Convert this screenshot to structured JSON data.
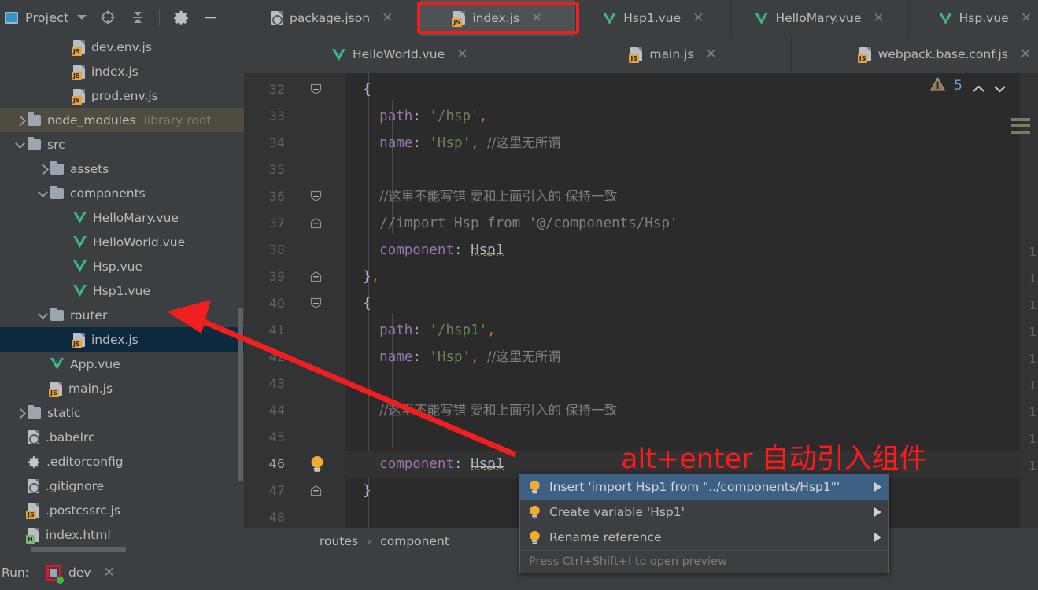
{
  "project_panel": {
    "title": "Project",
    "icons": [
      "project-window-icon",
      "chevron-down-icon",
      "locate-target-icon",
      "collapse-all-icon",
      "gear-icon",
      "minimize-icon"
    ],
    "tree": [
      {
        "label": "dev.env.js",
        "icon": "js-file-icon",
        "indent": 3,
        "arrow": "none"
      },
      {
        "label": "index.js",
        "icon": "js-file-icon",
        "indent": 3,
        "arrow": "none"
      },
      {
        "label": "prod.env.js",
        "icon": "js-file-icon",
        "indent": 3,
        "arrow": "none"
      },
      {
        "label": "node_modules",
        "icon": "folder-icon",
        "indent": 1,
        "arrow": "right",
        "sub": "library root",
        "state": "library"
      },
      {
        "label": "src",
        "icon": "folder-icon",
        "indent": 1,
        "arrow": "down"
      },
      {
        "label": "assets",
        "icon": "folder-icon",
        "indent": 2,
        "arrow": "right"
      },
      {
        "label": "components",
        "icon": "folder-icon",
        "indent": 2,
        "arrow": "down"
      },
      {
        "label": "HelloMary.vue",
        "icon": "vue-file-icon",
        "indent": 3,
        "arrow": "none"
      },
      {
        "label": "HelloWorld.vue",
        "icon": "vue-file-icon",
        "indent": 3,
        "arrow": "none"
      },
      {
        "label": "Hsp.vue",
        "icon": "vue-file-icon",
        "indent": 3,
        "arrow": "none"
      },
      {
        "label": "Hsp1.vue",
        "icon": "vue-file-icon",
        "indent": 3,
        "arrow": "none"
      },
      {
        "label": "router",
        "icon": "folder-icon",
        "indent": 2,
        "arrow": "down"
      },
      {
        "label": "index.js",
        "icon": "js-file-icon",
        "indent": 3,
        "arrow": "none",
        "state": "selected"
      },
      {
        "label": "App.vue",
        "icon": "vue-file-icon",
        "indent": 2,
        "arrow": "none"
      },
      {
        "label": "main.js",
        "icon": "js-file-icon",
        "indent": 2,
        "arrow": "none"
      },
      {
        "label": "static",
        "icon": "folder-icon",
        "indent": 1,
        "arrow": "right"
      },
      {
        "label": ".babelrc",
        "icon": "config-file-icon",
        "indent": 1,
        "arrow": "none"
      },
      {
        "label": ".editorconfig",
        "icon": "gear-file-icon",
        "indent": 1,
        "arrow": "none"
      },
      {
        "label": ".gitignore",
        "icon": "ignore-file-icon",
        "indent": 1,
        "arrow": "none"
      },
      {
        "label": ".postcssrc.js",
        "icon": "js-file-icon",
        "indent": 1,
        "arrow": "none"
      },
      {
        "label": "index.html",
        "icon": "html-file-icon",
        "indent": 1,
        "arrow": "none"
      }
    ]
  },
  "tabs": {
    "row1": [
      {
        "label": "package.json",
        "icon": "json-file-icon",
        "active": false
      },
      {
        "label": "index.js",
        "icon": "js-file-icon",
        "active": true,
        "highlighted": true
      },
      {
        "label": "Hsp1.vue",
        "icon": "vue-file-icon",
        "active": false
      },
      {
        "label": "HelloMary.vue",
        "icon": "vue-file-icon",
        "active": false
      },
      {
        "label": "Hsp.vue",
        "icon": "vue-file-icon",
        "active": false
      }
    ],
    "row2": [
      {
        "label": "HelloWorld.vue",
        "icon": "vue-file-icon",
        "active": false
      },
      {
        "label": "main.js",
        "icon": "js-file-icon",
        "active": false
      },
      {
        "label": "webpack.base.conf.js",
        "icon": "js-file-icon",
        "active": false
      }
    ]
  },
  "editor": {
    "first_line": 32,
    "current_line": 46,
    "warning_icon": "warning-triangle-icon",
    "warning_count": "5",
    "nav_up_icon": "chevron-up-icon",
    "nav_down_icon": "chevron-down-icon",
    "marks_icon": "inspection-marks-icon",
    "lines": [
      {
        "n": 32,
        "fold": "end-down",
        "segs": [
          {
            "t": "  {",
            "c": "brace"
          }
        ]
      },
      {
        "n": 33,
        "segs": [
          {
            "t": "    ",
            "c": "punct"
          },
          {
            "t": "path",
            "c": "key"
          },
          {
            "t": ": ",
            "c": "punct"
          },
          {
            "t": "'/hsp'",
            "c": "str"
          },
          {
            "t": ",",
            "c": "comma"
          }
        ]
      },
      {
        "n": 34,
        "segs": [
          {
            "t": "    ",
            "c": "punct"
          },
          {
            "t": "name",
            "c": "key"
          },
          {
            "t": ": ",
            "c": "punct"
          },
          {
            "t": "'Hsp'",
            "c": "str"
          },
          {
            "t": ",",
            "c": "comma"
          },
          {
            "t": " ",
            "c": "punct"
          },
          {
            "t": "//这里无所谓",
            "c": "comment-cn"
          }
        ]
      },
      {
        "n": 35,
        "segs": []
      },
      {
        "n": 36,
        "fold": "end-down",
        "segs": [
          {
            "t": "    ",
            "c": "punct"
          },
          {
            "t": "//这里不能写错 要和上面引入的 保持一致",
            "c": "comment-cn"
          }
        ]
      },
      {
        "n": 37,
        "fold": "end-up",
        "segs": [
          {
            "t": "    ",
            "c": "punct"
          },
          {
            "t": "//import Hsp from '@/components/Hsp'",
            "c": "comment"
          }
        ]
      },
      {
        "n": 38,
        "segs": [
          {
            "t": "    ",
            "c": "punct"
          },
          {
            "t": "component",
            "c": "key"
          },
          {
            "t": ": ",
            "c": "punct"
          },
          {
            "t": "Hsp1",
            "c": "ident-error"
          }
        ]
      },
      {
        "n": 39,
        "fold": "end-up",
        "segs": [
          {
            "t": "  }",
            "c": "brace"
          },
          {
            "t": ",",
            "c": "comma"
          }
        ]
      },
      {
        "n": 40,
        "fold": "end-down",
        "segs": [
          {
            "t": "  {",
            "c": "brace"
          }
        ]
      },
      {
        "n": 41,
        "segs": [
          {
            "t": "    ",
            "c": "punct"
          },
          {
            "t": "path",
            "c": "key"
          },
          {
            "t": ": ",
            "c": "punct"
          },
          {
            "t": "'/hsp1'",
            "c": "str"
          },
          {
            "t": ",",
            "c": "comma"
          }
        ]
      },
      {
        "n": 42,
        "segs": [
          {
            "t": "    ",
            "c": "punct"
          },
          {
            "t": "name",
            "c": "key"
          },
          {
            "t": ": ",
            "c": "punct"
          },
          {
            "t": "'Hsp'",
            "c": "str"
          },
          {
            "t": ",",
            "c": "comma"
          },
          {
            "t": " ",
            "c": "punct"
          },
          {
            "t": "//这里无所谓",
            "c": "comment-cn"
          }
        ]
      },
      {
        "n": 43,
        "segs": []
      },
      {
        "n": 44,
        "segs": [
          {
            "t": "    ",
            "c": "punct"
          },
          {
            "t": "//这里不能写错 要和上面引入的 保持一致",
            "c": "comment-cn"
          }
        ]
      },
      {
        "n": 45,
        "segs": []
      },
      {
        "n": 46,
        "bulb": true,
        "current": true,
        "segs": [
          {
            "t": "    ",
            "c": "punct"
          },
          {
            "t": "component",
            "c": "key"
          },
          {
            "t": ": ",
            "c": "punct"
          },
          {
            "t": "Hsp1",
            "c": "ident-error"
          }
        ]
      },
      {
        "n": 47,
        "fold": "end-up",
        "segs": [
          {
            "t": "  }",
            "c": "brace"
          }
        ]
      },
      {
        "n": 48,
        "segs": []
      }
    ]
  },
  "right_sliver": {
    "line_numbers": [
      "1",
      "1",
      "1",
      "1",
      "1",
      "1",
      "1",
      "1",
      "1"
    ]
  },
  "breadcrumb": {
    "items": [
      "routes",
      "component"
    ],
    "separator": "›"
  },
  "intention_popup": {
    "items": [
      {
        "label": "Insert 'import Hsp1 from \"../components/Hsp1\"'",
        "selected": true,
        "icon": "lightbulb-icon",
        "submenu": true
      },
      {
        "label": "Create variable 'Hsp1'",
        "selected": false,
        "icon": "lightbulb-icon",
        "submenu": true
      },
      {
        "label": "Rename reference",
        "selected": false,
        "icon": "lightbulb-icon",
        "submenu": true
      }
    ],
    "hint": "Press Ctrl+Shift+I to open preview"
  },
  "annotation": {
    "note": "alt+enter 自动引入组件",
    "color": "#ff1a1a",
    "arrow_icon": "red-arrow-pointer"
  },
  "status_bar": {
    "run_label": "Run:",
    "run_tab_label": "dev",
    "run_icon": "run-config-icon",
    "close_icon": "close-icon"
  },
  "colors": {
    "panel_bg": "#3c3f41",
    "editor_bg": "#2b2b2b",
    "gutter_bg": "#313335",
    "tab_active": "#4e5254",
    "tree_selected": "#0d293e",
    "library_root": "#4f4b41",
    "popup_selected": "#3d6185",
    "annotation_red": "#ff1a1a",
    "keyword_purple": "#9876aa",
    "string_green": "#6a8759",
    "comment_gray": "#808080",
    "punct_orange": "#cc7832"
  }
}
